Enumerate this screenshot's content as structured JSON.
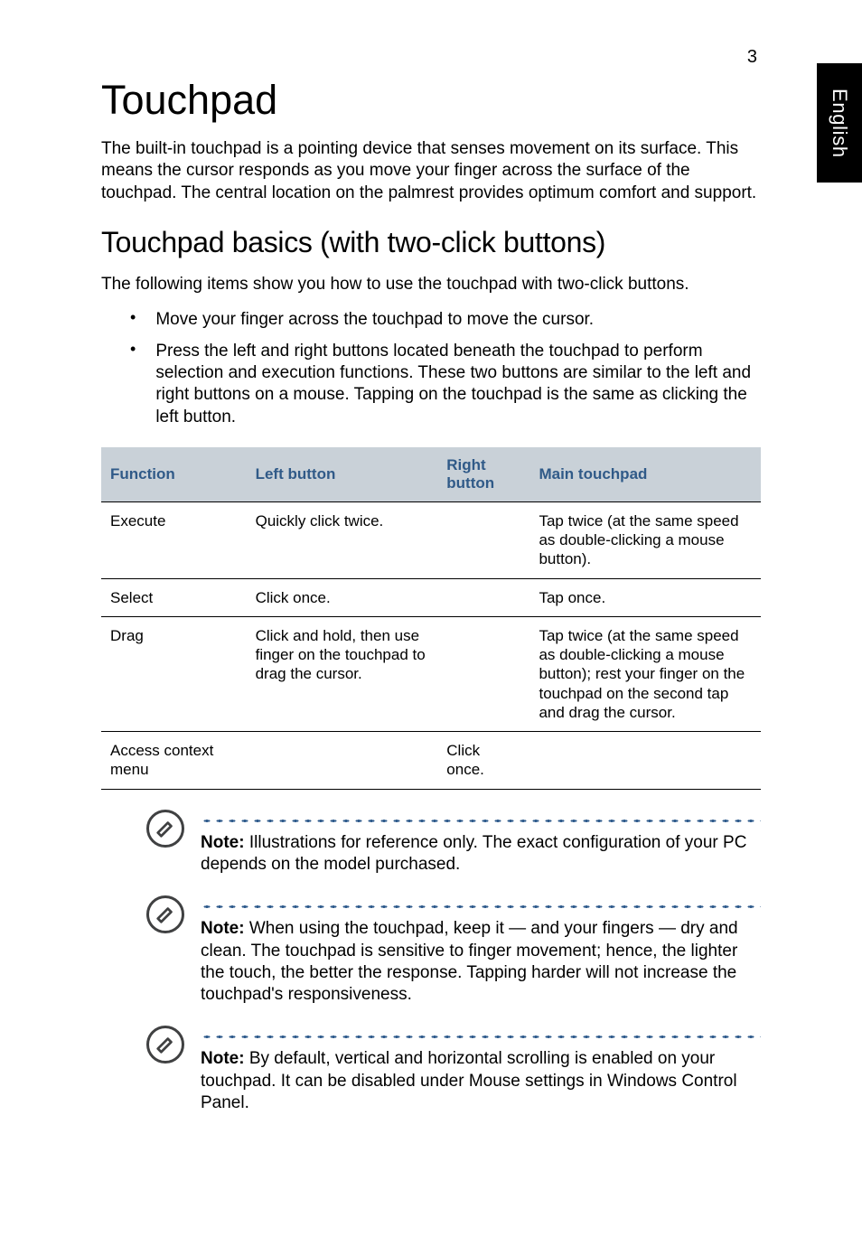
{
  "page": {
    "number": "3"
  },
  "side_tab": "English",
  "h1": "Touchpad",
  "intro": "The built-in touchpad is a pointing device that senses movement on its surface. This means the cursor responds as you move your finger across the surface of the touchpad. The central location on the palmrest provides optimum comfort and support.",
  "h2": "Touchpad basics (with two-click buttons)",
  "sub": "The following items show you how to use the touchpad with two-click buttons.",
  "bullets": [
    "Move your finger across the touchpad to move the cursor.",
    "Press the left and right buttons located beneath the touchpad to perform selection and execution functions. These two buttons are similar to the left and right buttons on a mouse. Tapping on the touchpad is the same as clicking the left button."
  ],
  "table": {
    "headers": {
      "function": "Function",
      "left": "Left button",
      "right_l1": "Right",
      "right_l2": "button",
      "main": "Main touchpad"
    },
    "rows": [
      {
        "function": "Execute",
        "left": "Quickly click twice.",
        "right": "",
        "main": "Tap twice (at the same speed as double-clicking a mouse button)."
      },
      {
        "function": "Select",
        "left": "Click once.",
        "right": "",
        "main": "Tap once."
      },
      {
        "function": "Drag",
        "left": "Click and hold, then use finger on the touchpad to drag the cursor.",
        "right": "",
        "main": "Tap twice (at the same speed as double-clicking a mouse button); rest your finger on the touchpad on the second tap and drag the cursor."
      },
      {
        "function": "Access context menu",
        "left": "",
        "right": "Click once.",
        "main": ""
      }
    ]
  },
  "notes": [
    {
      "bold": "Note:",
      "text": " Illustrations for reference only. The exact configuration of your PC depends on the model purchased."
    },
    {
      "bold": "Note:",
      "text": " When using the touchpad, keep it — and your fingers — dry and clean. The touchpad is sensitive to finger movement; hence, the lighter the touch, the better the response. Tapping harder will not increase the touchpad's responsiveness."
    },
    {
      "bold": "Note:",
      "text": " By default, vertical and horizontal scrolling is enabled on your touchpad. It can be disabled under Mouse settings in Windows Control Panel."
    }
  ]
}
